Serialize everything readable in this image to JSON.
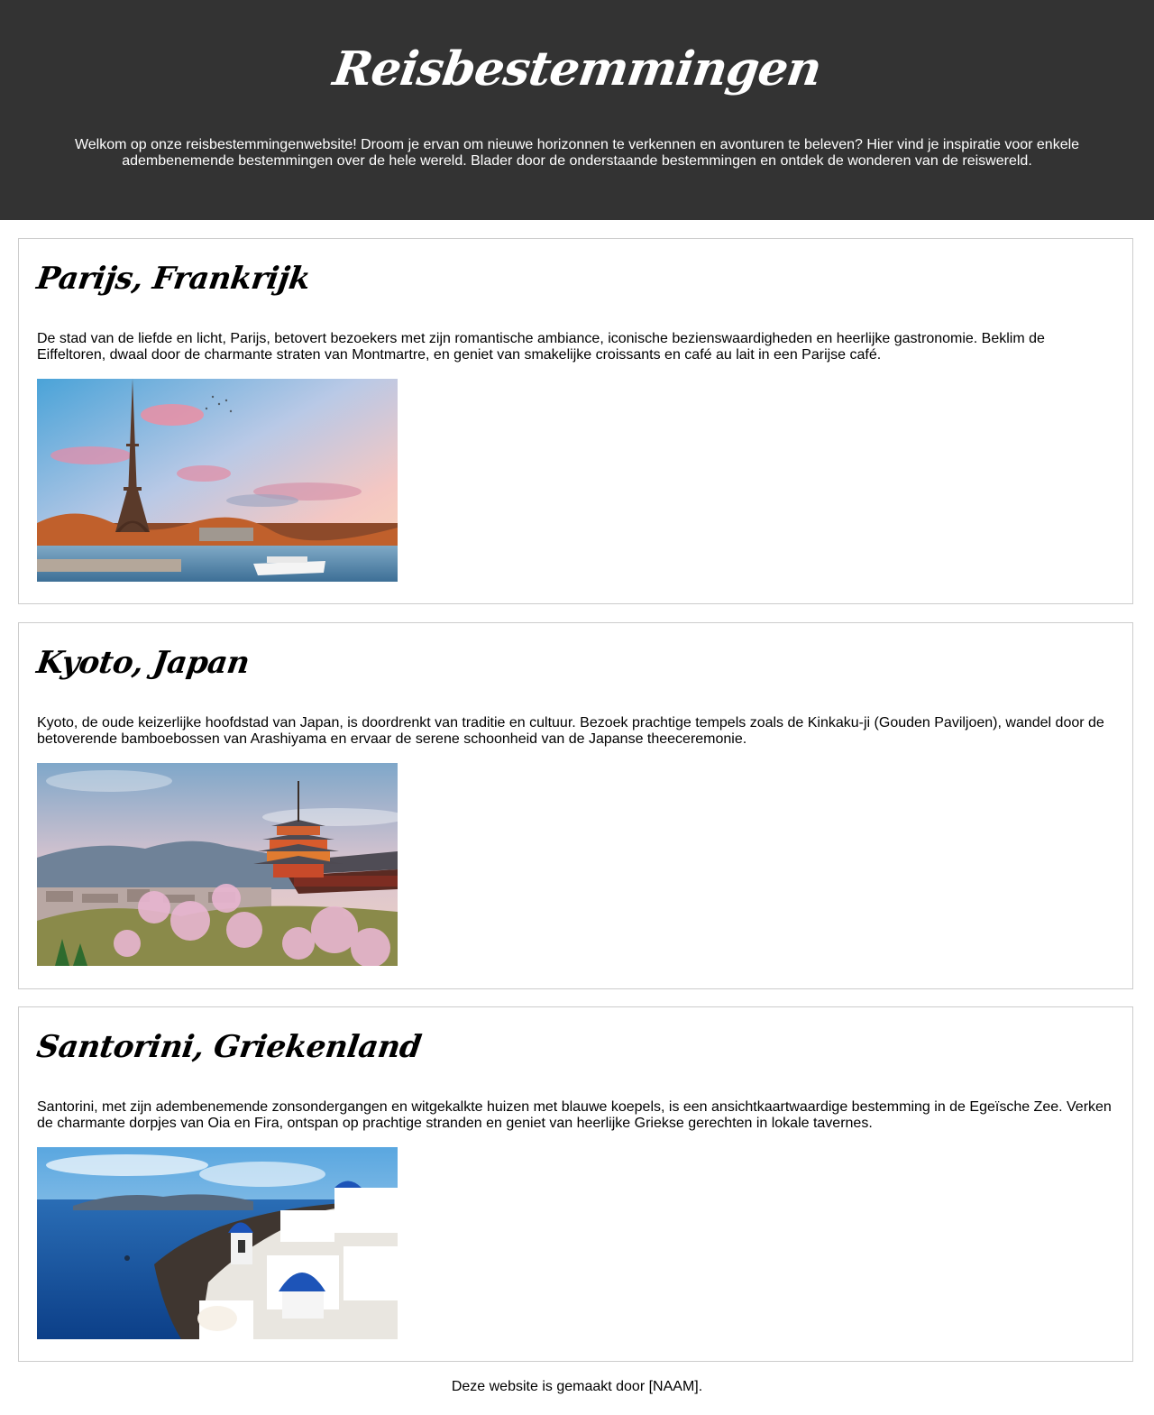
{
  "header": {
    "title": "Reisbestemmingen",
    "intro": "Welkom op onze reisbestemmingenwebsite! Droom je ervan om nieuwe horizonnen te verkennen en avonturen te beleven? Hier vind je inspiratie voor enkele adembenemende bestemmingen over de hele wereld. Blader door de onderstaande bestemmingen en ontdek de wonderen van de reiswereld."
  },
  "destinations": [
    {
      "title": "Parijs, Frankrijk",
      "description": "De stad van de liefde en licht, Parijs, betovert bezoekers met zijn romantische ambiance, iconische bezienswaardigheden en heerlijke gastronomie. Beklim de Eiffeltoren, dwaal door de charmante straten van Montmartre, en geniet van smakelijke croissants en café au lait in een Parijse café."
    },
    {
      "title": "Kyoto, Japan",
      "description": "Kyoto, de oude keizerlijke hoofdstad van Japan, is doordrenkt van traditie en cultuur. Bezoek prachtige tempels zoals de Kinkaku-ji (Gouden Paviljoen), wandel door de betoverende bamboebossen van Arashiyama en ervaar de serene schoonheid van de Japanse theeceremonie."
    },
    {
      "title": "Santorini, Griekenland",
      "description": "Santorini, met zijn adembenemende zonsondergangen en witgekalkte huizen met blauwe koepels, is een ansichtkaartwaardige bestemming in de Egeïsche Zee. Verken de charmante dorpjes van Oia en Fira, ontspan op prachtige stranden en geniet van heerlijke Griekse gerechten in lokale tavernes."
    }
  ],
  "footer": {
    "text": "Deze website is gemaakt door [NAAM]."
  },
  "colors": {
    "header_bg": "#333333",
    "card_border": "#cccccc"
  }
}
